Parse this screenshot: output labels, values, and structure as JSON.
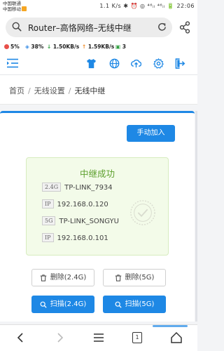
{
  "status_bar": {
    "carrier_line1": "中国联通",
    "carrier_line2": "中国移动",
    "right_text": "1.1 K/s ✱ ⏰ ◎ ⁴⁶ᵢₗ ⁴⁶ᵢₗ 🔋 22:06"
  },
  "browser": {
    "title": "Router–高恪网络–无线中继"
  },
  "stats": {
    "cpu": "5%",
    "mem": "38%",
    "down": "1.50KB/s",
    "up": "1.59KB/s",
    "devices": "3"
  },
  "colors": {
    "accent": "#1e88e5",
    "success": "#5c9f2c",
    "success_bg": "#f3fbe9"
  },
  "breadcrumb": {
    "home": "首页",
    "parent": "无线设置",
    "current": "无线中继",
    "separator": "/"
  },
  "card": {
    "add_button": "手动加入",
    "success_title": "中继成功",
    "rows": [
      {
        "tag": "2.4G",
        "value": "TP-LINK_7934"
      },
      {
        "tag": "IP",
        "value": "192.168.0.120"
      },
      {
        "tag": "5G",
        "value": "TP-LINK_SONGYU"
      },
      {
        "tag": "IP",
        "value": "192.168.0.101"
      }
    ],
    "delete_24": "删除(2.4G)",
    "delete_5": "删除(5G)",
    "scan_24": "扫描(2.4G)",
    "scan_5": "扫描(5G)"
  },
  "navbar": {
    "tabs_count": "1"
  }
}
